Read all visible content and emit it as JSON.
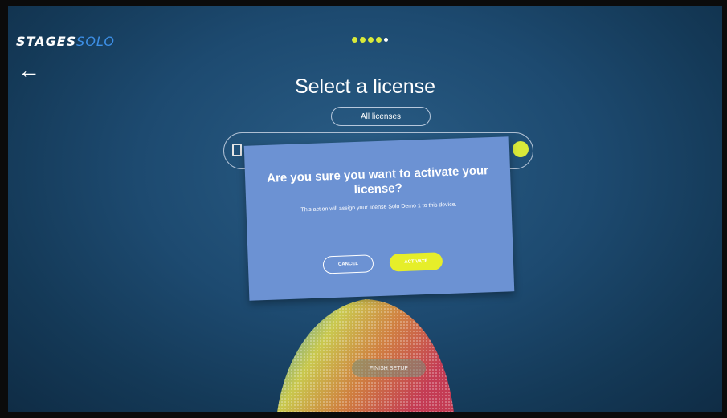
{
  "header": {
    "logo_main": "STAGES",
    "logo_sub": "SOLO",
    "progress_total": 5,
    "progress_completed": 4
  },
  "nav": {
    "back_glyph": "←"
  },
  "page": {
    "title": "Select a license",
    "filter_label": "All licenses"
  },
  "dialog": {
    "title": "Are you sure you want to activate your license?",
    "body": "This action will assign your license Solo Demo 1 to this device.",
    "cancel_label": "CANCEL",
    "activate_label": "ACTIVATE"
  },
  "footer": {
    "finish_label": "FINISH SETUP"
  },
  "colors": {
    "accent": "#d9e93a",
    "dialog": "#6c92d3",
    "background": "#1d4a70",
    "logo_blue": "#3d8fe6"
  }
}
